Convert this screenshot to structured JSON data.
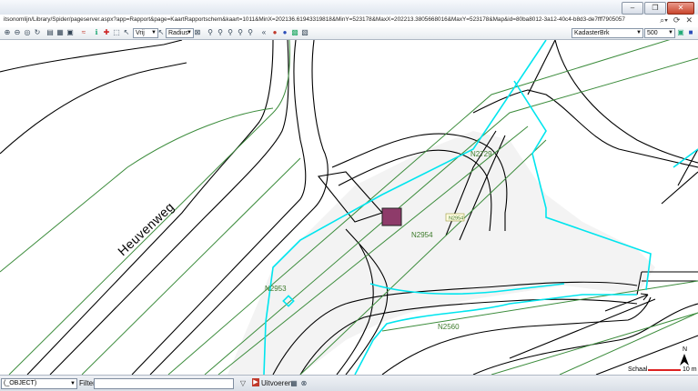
{
  "browser": {
    "url": "itsonomlijn/Library/Spider/pageserver.aspx?app=Rapport&page=KaartRapportschem&kaart=1011&MinX=202136.61943319818&MinY=523178&MaxX=202213.3805668016&MaxY=523178&Map&id=80ba8012-3a12-40c4-b8d3-de7fff7905057",
    "window_buttons": [
      "–",
      "❐",
      "✕"
    ]
  },
  "toolbar": {
    "mode_select": "Vrij",
    "radius_select": "Radius",
    "layer_select": "KadasterBrk",
    "scale_select": "500"
  },
  "map": {
    "road_label": "Heuvenweg",
    "parcels": [
      "N2729",
      "N2954",
      "N2953",
      "N2560"
    ],
    "parcel_badge": "N2954",
    "colors": {
      "parcel_line": "#00e5ee",
      "road_line": "#3c8c3c",
      "marker": "#8e3b6a"
    }
  },
  "scale": {
    "label": "Schaal",
    "value": "10 m"
  },
  "statusbar": {
    "object_select": "(_OBJECT)",
    "filter_label": "Filter",
    "filter_value": "",
    "execute_label": "Uitvoeren"
  }
}
